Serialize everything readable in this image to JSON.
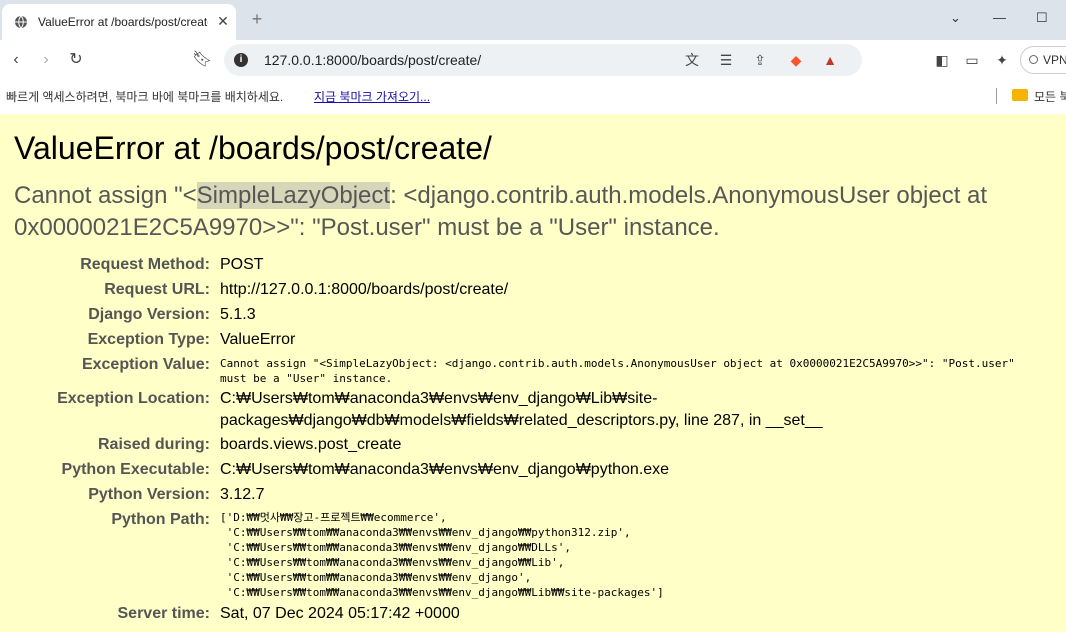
{
  "browser": {
    "tab_title": "ValueError at /boards/post/create/",
    "new_tab": "+",
    "url": "127.0.0.1:8000/boards/post/create/",
    "vpn_label": "VPN",
    "bookmarks_bar": {
      "message": "빠르게 액세스하려면, 북마크 바에 북마크를 배치하세요.",
      "import_link": "지금 북마크 가져오기...",
      "folder_label": "모든 북"
    }
  },
  "page": {
    "title": "ValueError at /boards/post/create/",
    "exception_value_prefix": "Cannot assign \"<",
    "exception_value_highlight": "SimpleLazyObject",
    "exception_value_suffix": ": <django.contrib.auth.models.AnonymousUser object at 0x0000021E2C5A9970>>\": \"Post.user\" must be a \"User\" instance.",
    "meta": [
      {
        "key": "Request Method:",
        "value": "POST"
      },
      {
        "key": "Request URL:",
        "value": "http://127.0.0.1:8000/boards/post/create/"
      },
      {
        "key": "Django Version:",
        "value": "5.1.3"
      },
      {
        "key": "Exception Type:",
        "value": "ValueError"
      },
      {
        "key": "Exception Value:",
        "value": "Cannot assign \"<SimpleLazyObject: <django.contrib.auth.models.AnonymousUser object at 0x0000021E2C5A9970>>\": \"Post.user\"\nmust be a \"User\" instance."
      },
      {
        "key": "Exception Location:",
        "value": "C:₩Users₩tom₩anaconda3₩envs₩env_django₩Lib₩site-\npackages₩django₩db₩models₩fields₩related_descriptors.py, line 287, in __set__"
      },
      {
        "key": "Raised during:",
        "value": "boards.views.post_create"
      },
      {
        "key": "Python Executable:",
        "value": "C:₩Users₩tom₩anaconda3₩envs₩env_django₩python.exe"
      },
      {
        "key": "Python Version:",
        "value": "3.12.7"
      },
      {
        "key": "Python Path:",
        "value": "['D:₩₩멋사₩₩장고-프로젝트₩₩ecommerce',\n 'C:₩₩Users₩₩tom₩₩anaconda3₩₩envs₩₩env_django₩₩python312.zip',\n 'C:₩₩Users₩₩tom₩₩anaconda3₩₩envs₩₩env_django₩₩DLLs',\n 'C:₩₩Users₩₩tom₩₩anaconda3₩₩envs₩₩env_django₩₩Lib',\n 'C:₩₩Users₩₩tom₩₩anaconda3₩₩envs₩₩env_django',\n 'C:₩₩Users₩₩tom₩₩anaconda3₩₩envs₩₩env_django₩₩Lib₩₩site-packages']"
      },
      {
        "key": "Server time:",
        "value": "Sat, 07 Dec 2024 05:17:42 +0000"
      }
    ]
  }
}
